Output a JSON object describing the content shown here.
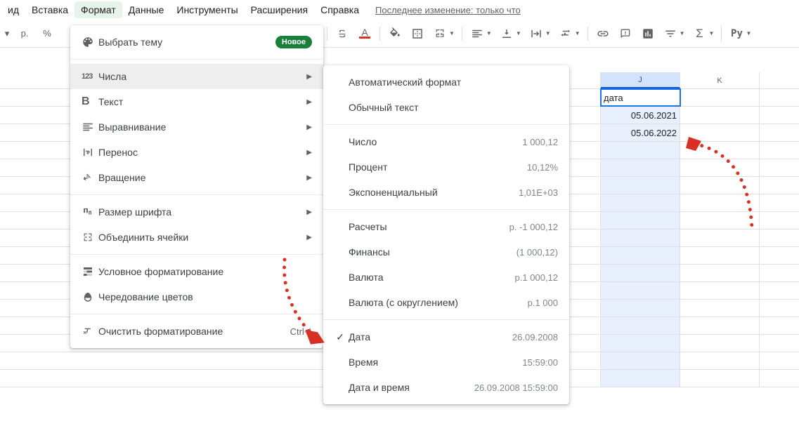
{
  "menu": {
    "items": [
      "ид",
      "Вставка",
      "Формат",
      "Данные",
      "Инструменты",
      "Расширения",
      "Справка"
    ],
    "last_edit": "Последнее изменение: только что"
  },
  "toolbar": {
    "currency": "р.",
    "percent": "%",
    "text_color_indicator": "A",
    "functions": "Σ",
    "python": "Py"
  },
  "format_menu": {
    "theme": "Выбрать тему",
    "new_badge": "Новое",
    "numbers": "Числа",
    "text": "Текст",
    "align": "Выравнивание",
    "wrap": "Перенос",
    "rotation": "Вращение",
    "font_size": "Размер шрифта",
    "merge": "Объединить ячейки",
    "conditional": "Условное форматирование",
    "alternating": "Чередование цветов",
    "clear": "Очистить форматирование",
    "clear_shortcut": "Ctrl+\\"
  },
  "number_menu": {
    "auto": "Автоматический формат",
    "plain": "Обычный текст",
    "number": {
      "label": "Число",
      "example": "1 000,12"
    },
    "percent": {
      "label": "Процент",
      "example": "10,12%"
    },
    "scientific": {
      "label": "Экспоненциальный",
      "example": "1,01E+03"
    },
    "accounting": {
      "label": "Расчеты",
      "example": "р. -1 000,12"
    },
    "financial": {
      "label": "Финансы",
      "example": "(1 000,12)"
    },
    "currency": {
      "label": "Валюта",
      "example": "р.1 000,12"
    },
    "currency_rounded": {
      "label": "Валюта (с округлением)",
      "example": "р.1 000"
    },
    "date": {
      "label": "Дата",
      "example": "26.09.2008"
    },
    "time": {
      "label": "Время",
      "example": "15:59:00"
    },
    "datetime": {
      "label": "Дата и время",
      "example": "26.09.2008 15:59:00"
    }
  },
  "sheet": {
    "columns": [
      "J",
      "K"
    ],
    "data": {
      "J1": "дата",
      "J2": "05.06.2021",
      "J3": "05.06.2022"
    }
  }
}
